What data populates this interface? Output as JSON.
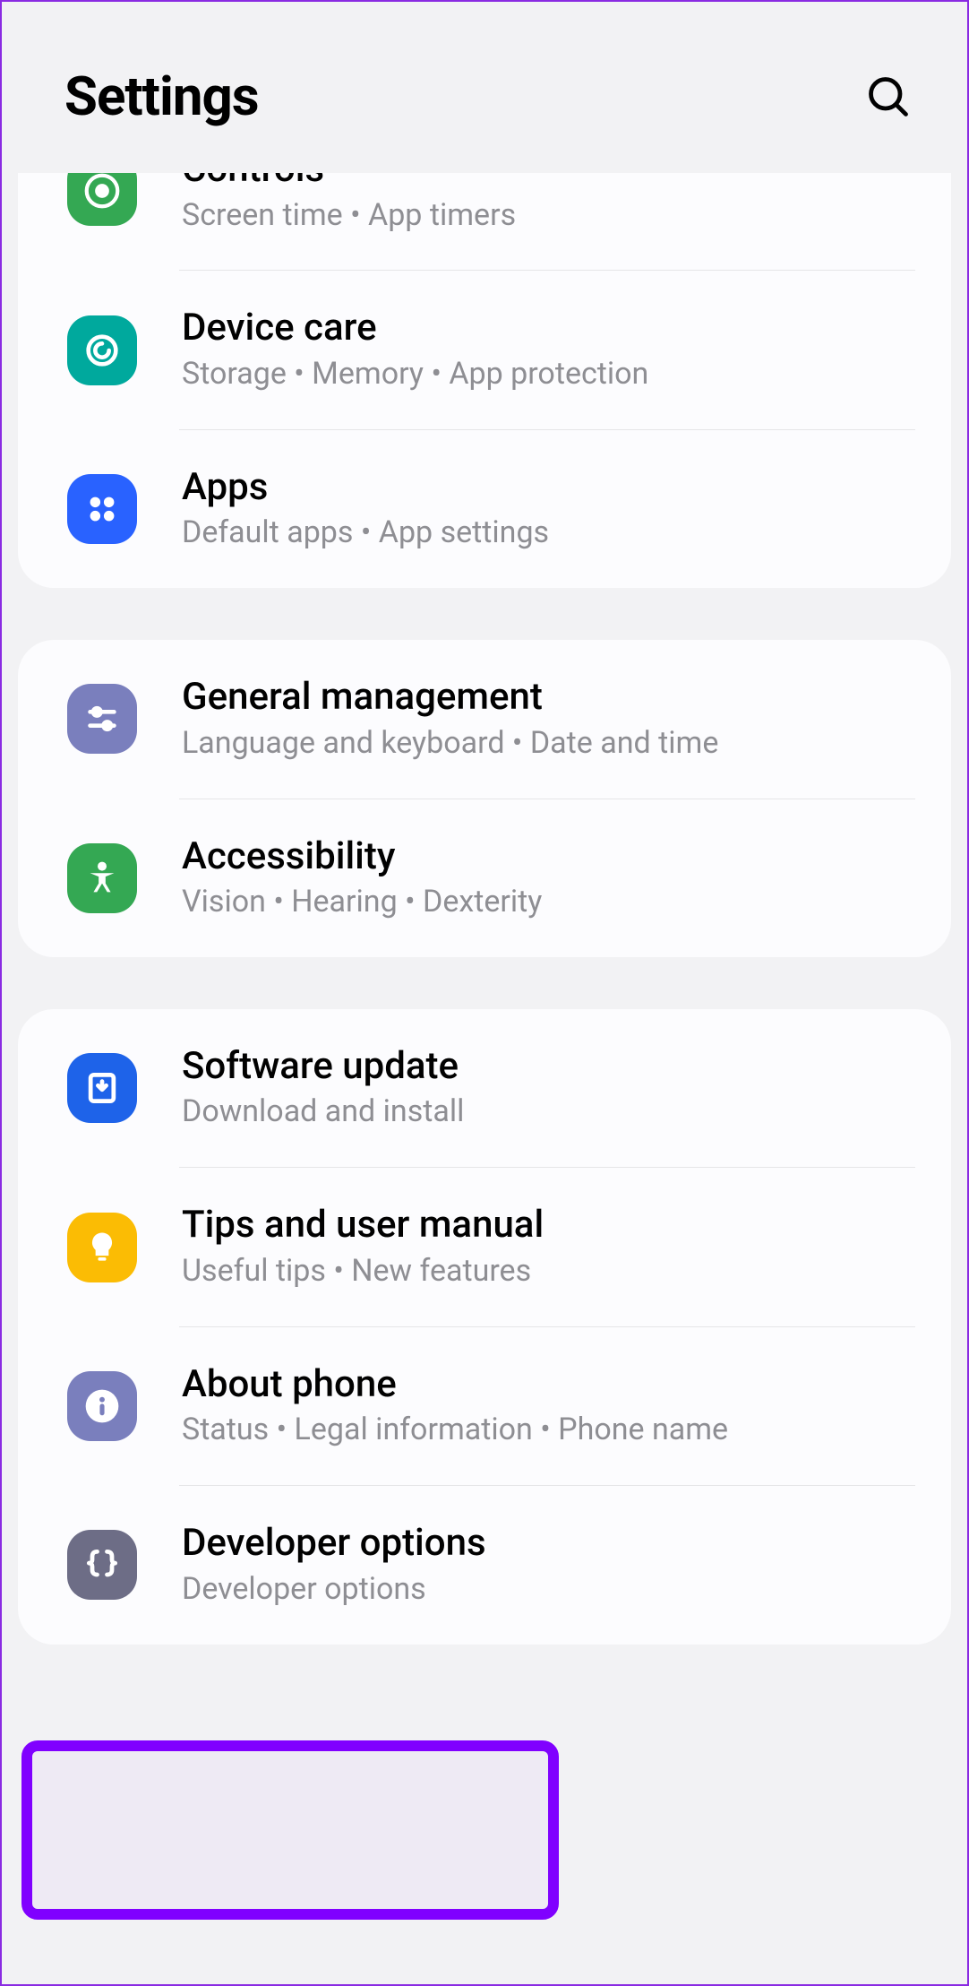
{
  "header": {
    "title": "Settings"
  },
  "groups": [
    {
      "items": [
        {
          "id": "controls",
          "icon": "controls-icon",
          "color": "c-green",
          "title": "Controls",
          "sub": "Screen time  •  App timers",
          "partial": true
        },
        {
          "id": "device-care",
          "icon": "device-care-icon",
          "color": "c-teal",
          "title": "Device care",
          "sub": "Storage  •  Memory  •  App protection"
        },
        {
          "id": "apps",
          "icon": "apps-icon",
          "color": "c-blue",
          "title": "Apps",
          "sub": "Default apps  •  App settings"
        }
      ]
    },
    {
      "items": [
        {
          "id": "general-management",
          "icon": "sliders-icon",
          "color": "c-slate",
          "title": "General management",
          "sub": "Language and keyboard  •  Date and time"
        },
        {
          "id": "accessibility",
          "icon": "accessibility-icon",
          "color": "c-green2",
          "title": "Accessibility",
          "sub": "Vision  •  Hearing  •  Dexterity"
        }
      ]
    },
    {
      "items": [
        {
          "id": "software-update",
          "icon": "download-icon",
          "color": "c-blue2",
          "title": "Software update",
          "sub": "Download and install"
        },
        {
          "id": "tips",
          "icon": "bulb-icon",
          "color": "c-amber",
          "title": "Tips and user manual",
          "sub": "Useful tips  •  New features"
        },
        {
          "id": "about-phone",
          "icon": "info-icon",
          "color": "c-slate2",
          "title": "About phone",
          "sub": "Status  •  Legal information  •  Phone name"
        },
        {
          "id": "developer-options",
          "icon": "braces-icon",
          "color": "c-slate3",
          "title": "Developer options",
          "sub": "Developer options"
        }
      ]
    }
  ]
}
